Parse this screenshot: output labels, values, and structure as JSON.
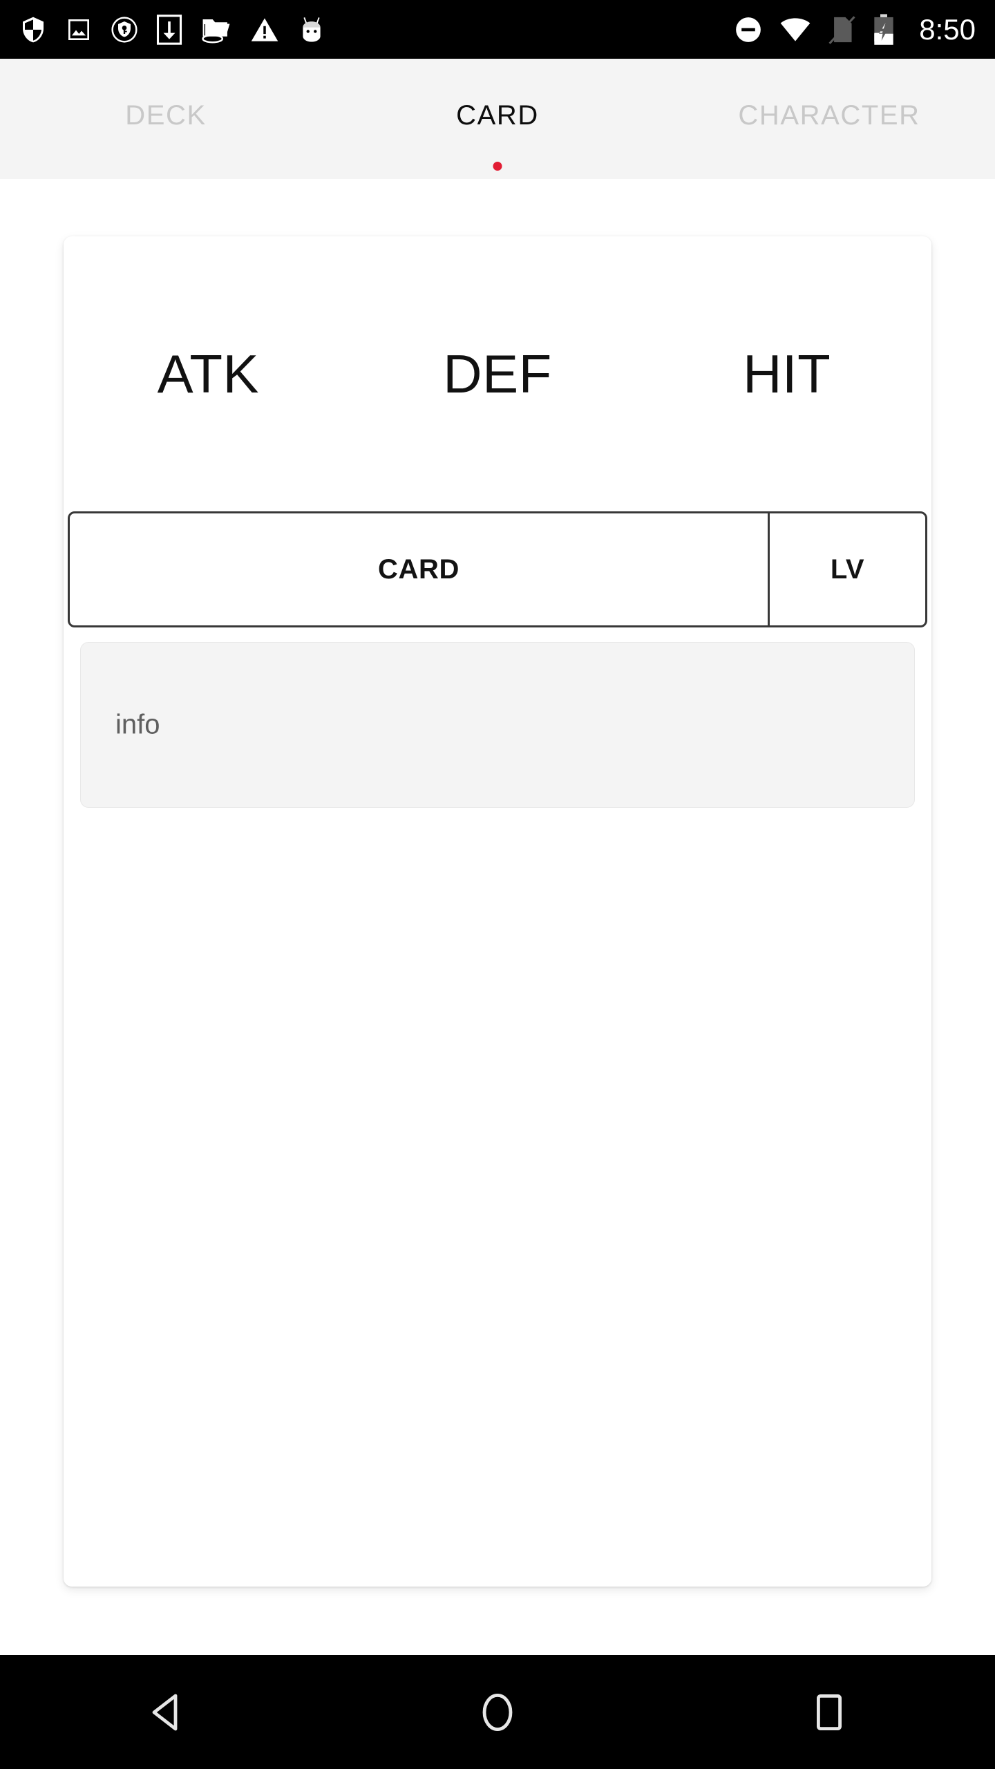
{
  "status_bar": {
    "left_icons": [
      "shield-icon",
      "photo-icon",
      "vpn-key-shield-icon",
      "download-icon",
      "folder-network-icon",
      "warning-triangle-icon",
      "android-mascot-icon"
    ],
    "right_icons": [
      "do-not-disturb-icon",
      "wifi-icon",
      "no-sim-icon",
      "battery-charging-icon"
    ],
    "time": "8:50"
  },
  "tabs": [
    {
      "label": "DECK",
      "active": false
    },
    {
      "label": "CARD",
      "active": true
    },
    {
      "label": "CHARACTER",
      "active": false
    }
  ],
  "card": {
    "stats": [
      {
        "label": "ATK"
      },
      {
        "label": "DEF"
      },
      {
        "label": "HIT"
      }
    ],
    "selector": {
      "card_label": "CARD",
      "lv_label": "LV"
    },
    "info": {
      "text": "info"
    }
  },
  "nav_bar": {
    "back": "back-triangle-icon",
    "home": "home-circle-icon",
    "recents": "recents-square-icon"
  },
  "colors": {
    "accent_dot": "#e21c33",
    "tab_bar_bg": "#f4f4f4",
    "tab_inactive": "#c8c8c8",
    "tab_active": "#0d0d0d",
    "box_border": "#383838",
    "info_bg": "#f4f4f4",
    "info_text": "#5f5f5f",
    "system_bar_bg": "#000000"
  }
}
